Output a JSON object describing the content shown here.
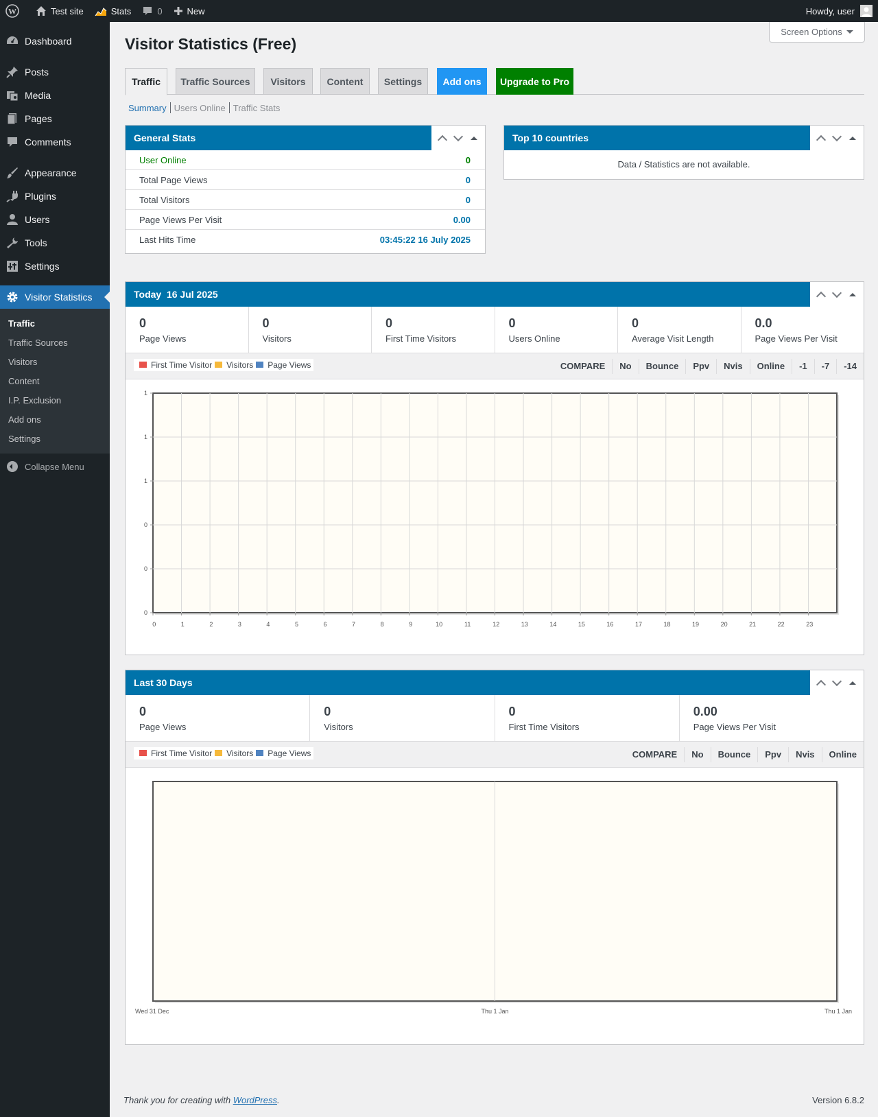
{
  "adminbar": {
    "site_name": "Test site",
    "stats": "Stats",
    "comments_count": "0",
    "new": "New",
    "howdy": "Howdy, user"
  },
  "sidebar": {
    "items": [
      {
        "label": "Dashboard",
        "icon": "dashboard-icon"
      },
      {
        "label": "Posts",
        "icon": "pin-icon"
      },
      {
        "label": "Media",
        "icon": "media-icon"
      },
      {
        "label": "Pages",
        "icon": "pages-icon"
      },
      {
        "label": "Comments",
        "icon": "comment-icon"
      },
      {
        "label": "Appearance",
        "icon": "brush-icon"
      },
      {
        "label": "Plugins",
        "icon": "plugin-icon"
      },
      {
        "label": "Users",
        "icon": "user-icon"
      },
      {
        "label": "Tools",
        "icon": "wrench-icon"
      },
      {
        "label": "Settings",
        "icon": "settings-icon"
      },
      {
        "label": "Visitor Statistics",
        "icon": "gear-icon"
      }
    ],
    "submenu": [
      "Traffic",
      "Traffic Sources",
      "Visitors",
      "Content",
      "I.P. Exclusion",
      "Add ons",
      "Settings"
    ],
    "collapse": "Collapse Menu"
  },
  "screen_options": "Screen Options",
  "page_title": "Visitor Statistics (Free)",
  "tabs": [
    "Traffic",
    "Traffic Sources",
    "Visitors",
    "Content",
    "Settings",
    "Add ons",
    "Upgrade to Pro"
  ],
  "subnav": [
    "Summary",
    "Users Online",
    "Traffic Stats"
  ],
  "general_stats": {
    "title": "General Stats",
    "rows": [
      {
        "label": "User Online",
        "value": "0"
      },
      {
        "label": "Total Page Views",
        "value": "0"
      },
      {
        "label": "Total Visitors",
        "value": "0"
      },
      {
        "label": "Page Views Per Visit",
        "value": "0.00"
      },
      {
        "label": "Last Hits Time",
        "value": "03:45:22 16 July 2025"
      }
    ]
  },
  "top_countries": {
    "title": "Top 10 countries",
    "message": "Data / Statistics are not available."
  },
  "today": {
    "title": "Today  16 Jul 2025",
    "stats": [
      {
        "num": "0",
        "label": "Page Views"
      },
      {
        "num": "0",
        "label": "Visitors"
      },
      {
        "num": "0",
        "label": "First Time Visitors"
      },
      {
        "num": "0",
        "label": "Users Online"
      },
      {
        "num": "0",
        "label": "Average Visit Length"
      },
      {
        "num": "0.0",
        "label": "Page Views Per Visit"
      }
    ],
    "legend": [
      "First Time Visitor",
      "Visitors",
      "Page Views"
    ],
    "compare": [
      "COMPARE",
      "No",
      "Bounce",
      "Ppv",
      "Nvis",
      "Online",
      "-1",
      "-7",
      "-14"
    ]
  },
  "last30": {
    "title": "Last 30 Days",
    "stats": [
      {
        "num": "0",
        "label": "Page Views"
      },
      {
        "num": "0",
        "label": "Visitors"
      },
      {
        "num": "0",
        "label": "First Time Visitors"
      },
      {
        "num": "0.00",
        "label": "Page Views Per Visit"
      }
    ],
    "legend": [
      "First Time Visitor",
      "Visitors",
      "Page Views"
    ],
    "compare": [
      "COMPARE",
      "No",
      "Bounce",
      "Ppv",
      "Nvis",
      "Online"
    ]
  },
  "chart_data": [
    {
      "type": "line",
      "x": [
        0,
        1,
        2,
        3,
        4,
        5,
        6,
        7,
        8,
        9,
        10,
        11,
        12,
        13,
        14,
        15,
        16,
        17,
        18,
        19,
        20,
        21,
        22,
        23
      ],
      "y_tick_labels": [
        "1",
        "1",
        "1",
        "0",
        "0",
        "0"
      ],
      "series": [
        {
          "name": "First Time Visitor",
          "color": "#e8524b",
          "values": []
        },
        {
          "name": "Visitors",
          "color": "#f6b93b",
          "values": []
        },
        {
          "name": "Page Views",
          "color": "#5083c0",
          "values": []
        }
      ],
      "grid": true,
      "legend": "top-left"
    },
    {
      "type": "line",
      "x_tick_labels": [
        "Wed 31 Dec",
        "Thu 1 Jan",
        "Thu 1 Jan"
      ],
      "series": [
        {
          "name": "First Time Visitor",
          "color": "#e8524b",
          "values": []
        },
        {
          "name": "Visitors",
          "color": "#f6b93b",
          "values": []
        },
        {
          "name": "Page Views",
          "color": "#5083c0",
          "values": []
        }
      ],
      "grid": true,
      "legend": "top-left"
    }
  ],
  "footer": {
    "thanks_prefix": "Thank you for creating with ",
    "link": "WordPress",
    "suffix": ".",
    "version": "Version 6.8.2"
  }
}
